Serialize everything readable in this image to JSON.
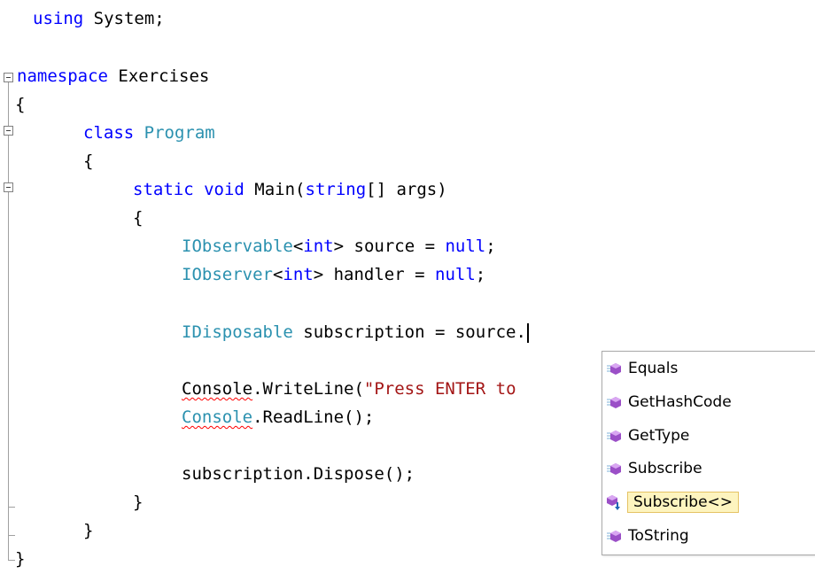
{
  "code": {
    "lines": [
      "using System;",
      "namespace Exercises",
      "{",
      "class Program",
      "{",
      "static void Main(string[] args)",
      "{",
      "IObservable<int> source = null;",
      "IObserver<int> handler = null;",
      "IDisposable subscription = source.",
      "Console.WriteLine(\"Press ENTER to",
      "Console.ReadLine();",
      "subscription.Dispose();",
      "}",
      "}",
      "}"
    ]
  },
  "intellisense": {
    "items": [
      {
        "label": "Equals",
        "icon": "method-icon"
      },
      {
        "label": "GetHashCode",
        "icon": "method-icon"
      },
      {
        "label": "GetType",
        "icon": "method-icon"
      },
      {
        "label": "Subscribe",
        "icon": "method-icon"
      },
      {
        "label": "Subscribe<>",
        "icon": "extension-method-icon",
        "selected": true
      },
      {
        "label": "ToString",
        "icon": "method-icon"
      }
    ]
  },
  "colors": {
    "keyword": "#0000ff",
    "type": "#2b91af",
    "string": "#a31515",
    "selection_bg": "#fdf4bf",
    "selection_border": "#e5c365"
  }
}
